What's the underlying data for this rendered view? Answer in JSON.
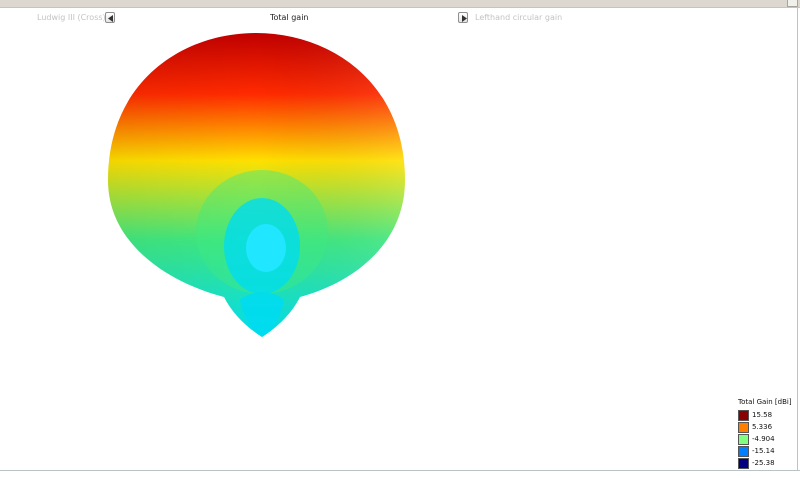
{
  "navigator": {
    "prev_label": "Ludwig III (Cross)",
    "current_label": "Total gain",
    "next_label": "Lefthand circular gain"
  },
  "legend": {
    "title": "Total Gain [dBi]",
    "entries": [
      {
        "value": "15.58",
        "color": "#8b0000"
      },
      {
        "value": "5.336",
        "color": "#ff8000"
      },
      {
        "value": "-4.904",
        "color": "#80ff80"
      },
      {
        "value": "-15.14",
        "color": "#0080ff"
      },
      {
        "value": "-25.38",
        "color": "#000080"
      }
    ]
  },
  "colors": {
    "top": "#c00000",
    "upper": "#ff2a00",
    "middle": "#ffe000",
    "lower": "#40e880",
    "bottom": "#00dcf0",
    "core": "#20e6ff"
  }
}
